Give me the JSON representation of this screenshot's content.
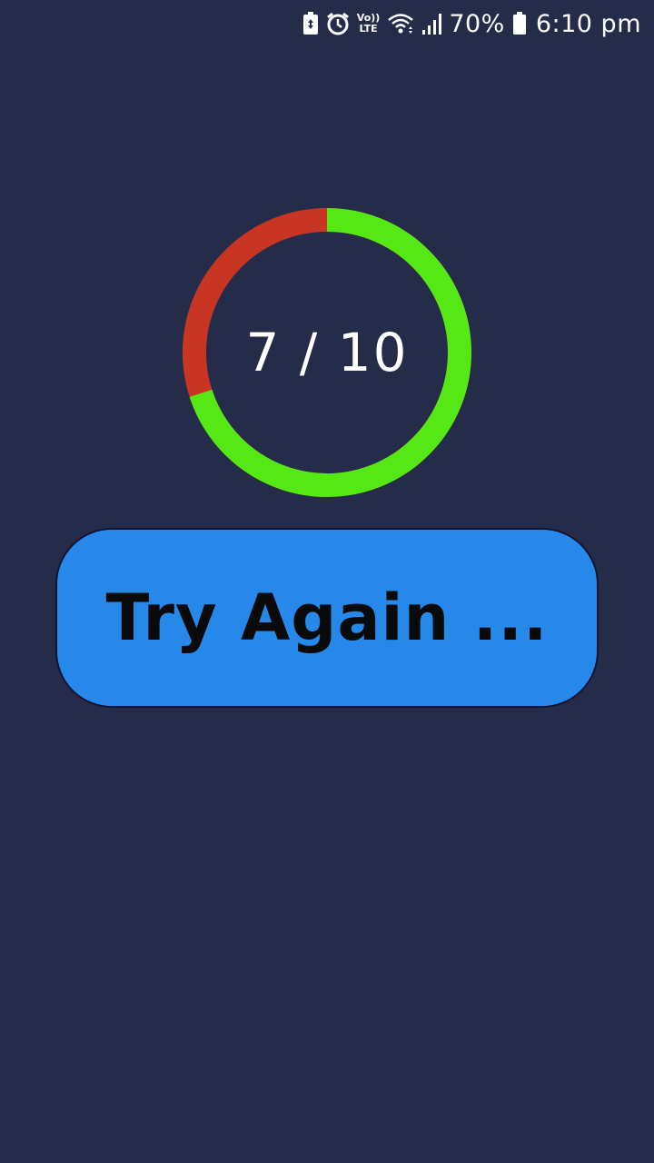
{
  "status_bar": {
    "volte_top": "Vo))",
    "volte_bottom": "LTE",
    "battery_percent": "70%",
    "time": "6:10 pm",
    "icons": [
      "battery-saver-icon",
      "alarm-icon",
      "volte-icon",
      "wifi-icon",
      "signal-icon",
      "battery-icon"
    ]
  },
  "score": {
    "text": "7 / 10",
    "correct": 7,
    "total": 10,
    "correct_color": "#56e815",
    "wrong_color": "#c93523"
  },
  "action": {
    "label": "Try Again ..."
  },
  "colors": {
    "background": "#252c4a",
    "button": "#2689ea"
  }
}
